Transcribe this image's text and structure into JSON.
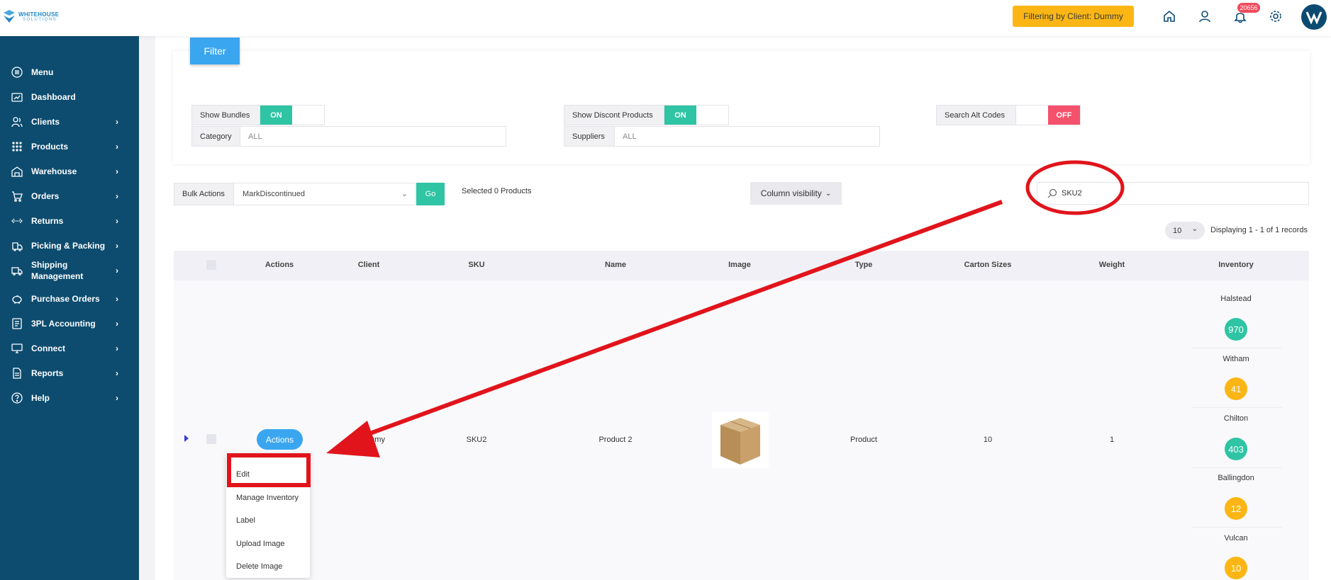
{
  "header": {
    "logo_line1": "WHITEHOUSE",
    "logo_line2": "SOLUTIONS",
    "client_filter": "Filtering by Client: Dummy",
    "notification_count": "20656",
    "icons": [
      "home-icon",
      "user-icon",
      "bell-icon",
      "gear-icon",
      "avatar"
    ]
  },
  "sidebar": {
    "items": [
      {
        "label": "Menu",
        "icon": "menu-icon",
        "chevron": false
      },
      {
        "label": "Dashboard",
        "icon": "dashboard-icon",
        "chevron": false
      },
      {
        "label": "Clients",
        "icon": "clients-icon",
        "chevron": true
      },
      {
        "label": "Products",
        "icon": "grid-icon",
        "chevron": true
      },
      {
        "label": "Warehouse",
        "icon": "warehouse-icon",
        "chevron": true
      },
      {
        "label": "Orders",
        "icon": "cart-icon",
        "chevron": true
      },
      {
        "label": "Returns",
        "icon": "returns-icon",
        "chevron": true
      },
      {
        "label": "Picking & Packing",
        "icon": "picking-icon",
        "chevron": true
      },
      {
        "label": "Shipping Management",
        "icon": "truck-icon",
        "chevron": true
      },
      {
        "label": "Purchase Orders",
        "icon": "piggy-bank-icon",
        "chevron": true
      },
      {
        "label": "3PL Accounting",
        "icon": "accounting-icon",
        "chevron": true
      },
      {
        "label": "Connect",
        "icon": "monitor-icon",
        "chevron": true
      },
      {
        "label": "Reports",
        "icon": "reports-icon",
        "chevron": true
      },
      {
        "label": "Help",
        "icon": "help-icon",
        "chevron": true
      }
    ],
    "chevron_char": "›"
  },
  "filters": {
    "tab_label": "Filter",
    "show_bundles_label": "Show Bundles",
    "show_bundles_state": "ON",
    "show_discont_label": "Show Discont Products",
    "show_discont_state": "ON",
    "search_alt_label": "Search Alt Codes",
    "search_alt_state": "OFF",
    "category_label": "Category",
    "category_value": "ALL",
    "suppliers_label": "Suppliers",
    "suppliers_value": "ALL"
  },
  "toolbar": {
    "bulk_actions_label": "Bulk Actions",
    "bulk_action_value": "MarkDiscontinued",
    "go_label": "Go",
    "selected_text": "Selected 0 Products",
    "column_visibility_label": "Column visibility",
    "search_value": "SKU2",
    "page_length": "10",
    "displaying_text": "Displaying 1 - 1 of 1 records"
  },
  "table": {
    "headers": [
      "Actions",
      "Client",
      "SKU",
      "Name",
      "Image",
      "Type",
      "Carton Sizes",
      "Weight",
      "Inventory"
    ],
    "row": {
      "actions_label": "Actions",
      "client": "Dummy",
      "sku": "SKU2",
      "name": "Product 2",
      "type": "Product",
      "carton_sizes": "10",
      "weight": "1"
    },
    "inventory": [
      {
        "warehouse": "Halstead",
        "qty": "970",
        "color": "#2ec4a4"
      },
      {
        "warehouse": "Witham",
        "qty": "41",
        "color": "#fbb615"
      },
      {
        "warehouse": "Chilton",
        "qty": "403",
        "color": "#2ec4a4"
      },
      {
        "warehouse": "Ballingdon",
        "qty": "12",
        "color": "#fbb615"
      },
      {
        "warehouse": "Vulcan",
        "qty": "10",
        "color": "#fbb615"
      }
    ]
  },
  "actions_menu": {
    "items": [
      "Edit",
      "Manage Inventory",
      "Label",
      "Upload Image",
      "Delete Image"
    ]
  },
  "colors": {
    "sidebar": "#0d4c6f",
    "accent_blue": "#3aa6f0",
    "accent_green": "#2ec4a4",
    "accent_yellow": "#fbb615",
    "accent_red": "#f4516c",
    "annotation_red": "#e1141b"
  }
}
